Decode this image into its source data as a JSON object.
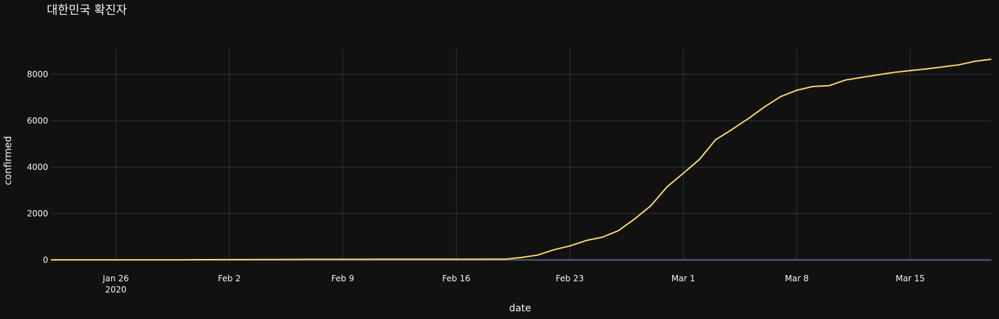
{
  "chart_data": {
    "type": "line",
    "title": "대한민국 확진자",
    "xlabel": "date",
    "ylabel": "confirmed",
    "x_ticks": [
      {
        "date": "2020-01-26",
        "label": "Jan 26",
        "sub": "2020"
      },
      {
        "date": "2020-02-02",
        "label": "Feb 2"
      },
      {
        "date": "2020-02-09",
        "label": "Feb 9"
      },
      {
        "date": "2020-02-16",
        "label": "Feb 16"
      },
      {
        "date": "2020-02-23",
        "label": "Feb 23"
      },
      {
        "date": "2020-03-01",
        "label": "Mar 1"
      },
      {
        "date": "2020-03-08",
        "label": "Mar 8"
      },
      {
        "date": "2020-03-15",
        "label": "Mar 15"
      }
    ],
    "y_ticks": [
      0,
      2000,
      4000,
      6000,
      8000
    ],
    "xlim": [
      "2020-01-22",
      "2020-03-20"
    ],
    "ylim": [
      -50,
      9100
    ],
    "grid": true,
    "colors": {
      "background": "#111111",
      "line": "#f8d869",
      "grid": "#283442",
      "text": "#f2f5fa"
    },
    "series": [
      {
        "color": "#f8d869",
        "points": [
          [
            "2020-01-22",
            1
          ],
          [
            "2020-01-23",
            1
          ],
          [
            "2020-01-24",
            2
          ],
          [
            "2020-01-25",
            2
          ],
          [
            "2020-01-26",
            3
          ],
          [
            "2020-01-27",
            4
          ],
          [
            "2020-01-28",
            4
          ],
          [
            "2020-01-29",
            4
          ],
          [
            "2020-01-30",
            4
          ],
          [
            "2020-01-31",
            11
          ],
          [
            "2020-02-01",
            12
          ],
          [
            "2020-02-02",
            15
          ],
          [
            "2020-02-03",
            15
          ],
          [
            "2020-02-04",
            16
          ],
          [
            "2020-02-05",
            19
          ],
          [
            "2020-02-06",
            23
          ],
          [
            "2020-02-07",
            24
          ],
          [
            "2020-02-08",
            24
          ],
          [
            "2020-02-09",
            25
          ],
          [
            "2020-02-10",
            27
          ],
          [
            "2020-02-11",
            28
          ],
          [
            "2020-02-12",
            28
          ],
          [
            "2020-02-13",
            28
          ],
          [
            "2020-02-14",
            28
          ],
          [
            "2020-02-15",
            28
          ],
          [
            "2020-02-16",
            29
          ],
          [
            "2020-02-17",
            30
          ],
          [
            "2020-02-18",
            31
          ],
          [
            "2020-02-19",
            31
          ],
          [
            "2020-02-20",
            104
          ],
          [
            "2020-02-21",
            204
          ],
          [
            "2020-02-22",
            433
          ],
          [
            "2020-02-23",
            602
          ],
          [
            "2020-02-24",
            833
          ],
          [
            "2020-02-25",
            977
          ],
          [
            "2020-02-26",
            1261
          ],
          [
            "2020-02-27",
            1766
          ],
          [
            "2020-02-28",
            2337
          ],
          [
            "2020-02-29",
            3150
          ],
          [
            "2020-03-01",
            3736
          ],
          [
            "2020-03-02",
            4335
          ],
          [
            "2020-03-03",
            5186
          ],
          [
            "2020-03-04",
            5621
          ],
          [
            "2020-03-05",
            6088
          ],
          [
            "2020-03-06",
            6593
          ],
          [
            "2020-03-07",
            7041
          ],
          [
            "2020-03-08",
            7314
          ],
          [
            "2020-03-09",
            7478
          ],
          [
            "2020-03-10",
            7513
          ],
          [
            "2020-03-11",
            7755
          ],
          [
            "2020-03-12",
            7869
          ],
          [
            "2020-03-13",
            7979
          ],
          [
            "2020-03-14",
            8086
          ],
          [
            "2020-03-15",
            8162
          ],
          [
            "2020-03-16",
            8236
          ],
          [
            "2020-03-17",
            8320
          ],
          [
            "2020-03-18",
            8413
          ],
          [
            "2020-03-19",
            8565
          ],
          [
            "2020-03-20",
            8652
          ]
        ]
      }
    ]
  }
}
